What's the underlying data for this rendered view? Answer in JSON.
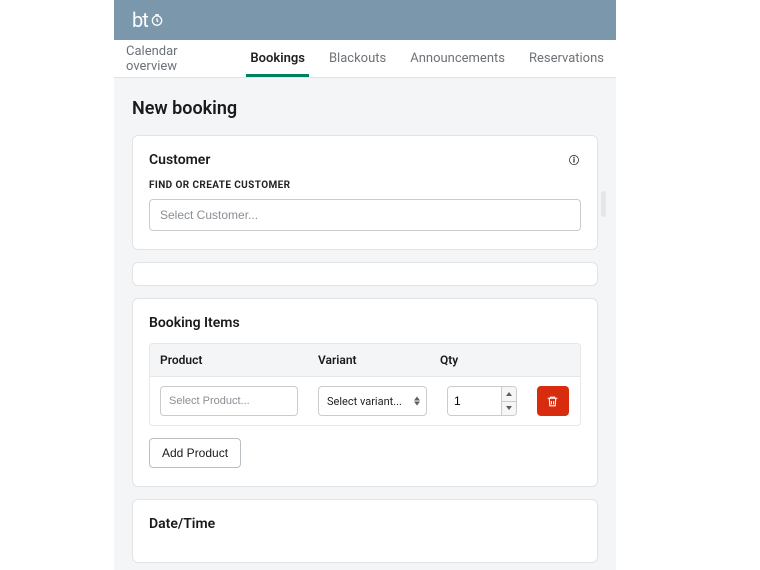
{
  "logo_text": "bt",
  "tabs": [
    {
      "label": "Calendar overview"
    },
    {
      "label": "Bookings"
    },
    {
      "label": "Blackouts"
    },
    {
      "label": "Announcements"
    },
    {
      "label": "Reservations"
    }
  ],
  "page_title": "New booking",
  "customer": {
    "heading": "Customer",
    "sublabel": "Find or Create Customer",
    "placeholder": "Select Customer..."
  },
  "booking_items": {
    "heading": "Booking Items",
    "columns": {
      "product": "Product",
      "variant": "Variant",
      "qty": "Qty"
    },
    "row": {
      "product_placeholder": "Select Product...",
      "variant_label": "Select variant...",
      "qty_value": "1"
    },
    "add_button": "Add Product"
  },
  "datetime": {
    "heading": "Date/Time"
  }
}
